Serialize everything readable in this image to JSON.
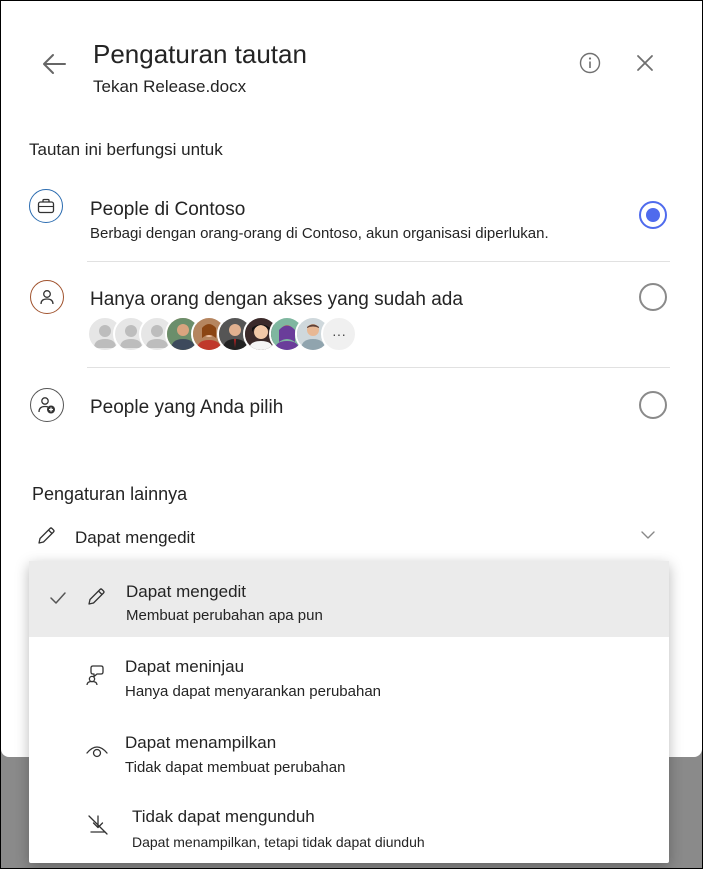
{
  "header": {
    "title": "Pengaturan tautan",
    "file_name": "Tekan Release.docx"
  },
  "scope": {
    "heading": "Tautan ini berfungsi untuk",
    "options": [
      {
        "title": "People di Contoso",
        "description": "Berbagi dengan orang-orang di Contoso, akun organisasi diperlukan.",
        "selected": true,
        "icon": "briefcase-icon"
      },
      {
        "title": "Hanya orang dengan akses yang sudah ada",
        "selected": false,
        "icon": "person-icon"
      },
      {
        "title": "People yang Anda pilih",
        "selected": false,
        "icon": "person-add-icon"
      }
    ],
    "avatars_more": "···"
  },
  "other_settings": {
    "heading": "Pengaturan lainnya",
    "permission_value": "Dapat mengedit"
  },
  "permission_menu": {
    "items": [
      {
        "title": "Dapat mengedit",
        "description": "Membuat perubahan apa pun",
        "selected": true,
        "icon": "pencil-icon"
      },
      {
        "title": "Dapat meninjau",
        "description": "Hanya dapat menyarankan perubahan",
        "selected": false,
        "icon": "review-icon"
      },
      {
        "title": "Dapat menampilkan",
        "description": "Tidak dapat membuat perubahan",
        "selected": false,
        "icon": "eye-icon"
      },
      {
        "title": "Tidak dapat mengunduh",
        "description": "Dapat menampilkan, tetapi tidak dapat diunduh",
        "selected": false,
        "icon": "no-download-icon"
      }
    ]
  },
  "colors": {
    "accent": "#4f6bed",
    "briefcase_ring": "#2b6cb0",
    "person_ring": "#a0522d",
    "selected_row": "#ebebeb"
  }
}
